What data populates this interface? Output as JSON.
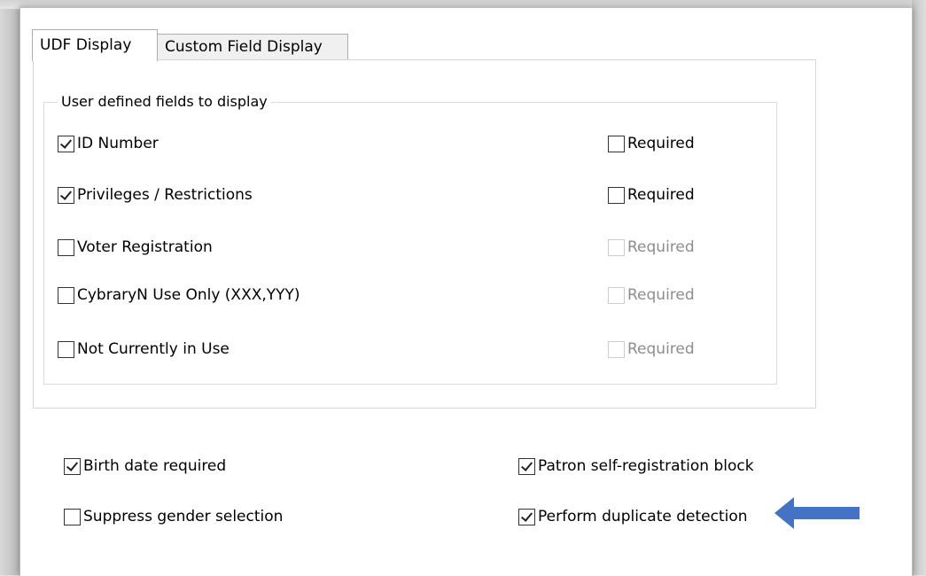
{
  "tabs": [
    {
      "label": "UDF Display",
      "active": true
    },
    {
      "label": "Custom Field Display",
      "active": false
    }
  ],
  "udf_group": {
    "title": "User defined fields to display",
    "fields": [
      {
        "label": "ID Number",
        "checked": true,
        "required_label": "Required",
        "required_checked": false,
        "required_enabled": true
      },
      {
        "label": "Privileges / Restrictions",
        "checked": true,
        "required_label": "Required",
        "required_checked": false,
        "required_enabled": true
      },
      {
        "label": "Voter Registration",
        "checked": false,
        "required_label": "Required",
        "required_checked": false,
        "required_enabled": false
      },
      {
        "label": "CybraryN Use Only (XXX,YYY)",
        "checked": false,
        "required_label": "Required",
        "required_checked": false,
        "required_enabled": false
      },
      {
        "label": "Not Currently in Use",
        "checked": false,
        "required_label": "Required",
        "required_checked": false,
        "required_enabled": false
      }
    ]
  },
  "options": {
    "birth_date_required": {
      "label": "Birth date required",
      "checked": true
    },
    "suppress_gender": {
      "label": "Suppress gender selection",
      "checked": false
    },
    "self_registration_block": {
      "label": "Patron self-registration block",
      "checked": true
    },
    "duplicate_detection": {
      "label": "Perform duplicate detection",
      "checked": true
    }
  },
  "colors": {
    "arrow": "#4472c4",
    "dialog_background": "#ffffff",
    "disabled_text": "#8d8d8d"
  },
  "icons": {
    "arrow": "arrow-left-icon",
    "checkbox": "checkbox-icon"
  }
}
